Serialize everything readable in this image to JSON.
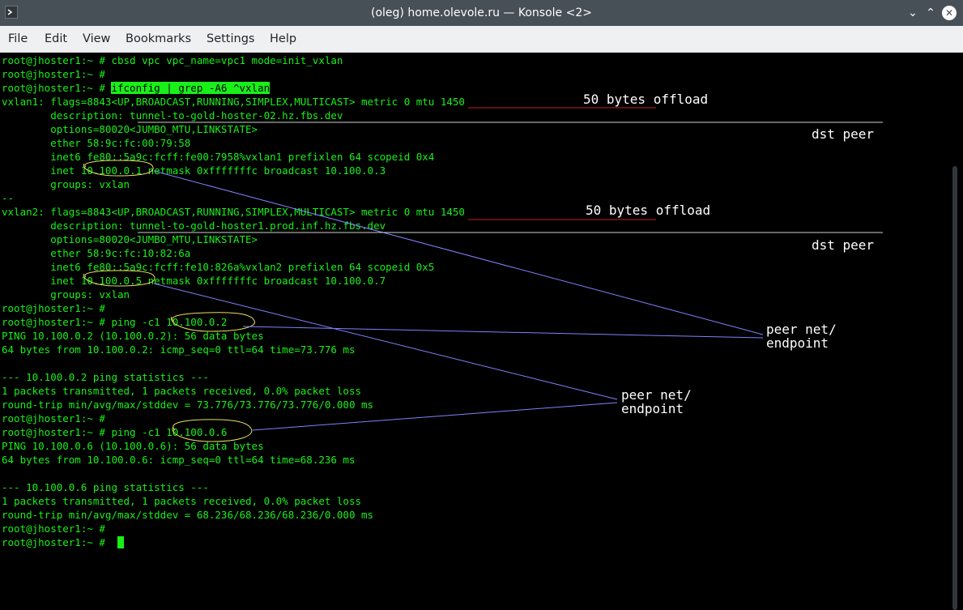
{
  "window": {
    "title": "(oleg) home.olevole.ru — Konsole <2>"
  },
  "menu": [
    "File",
    "Edit",
    "View",
    "Bookmarks",
    "Settings",
    "Help"
  ],
  "terminal": {
    "lines": [
      "root@jhoster1:~ # cbsd vpc vpc_name=vpc1 mode=init_vxlan",
      "root@jhoster1:~ #",
      "root@jhoster1:~ # ",
      "vxlan1: flags=8843<UP,BROADCAST,RUNNING,SIMPLEX,MULTICAST> metric 0 mtu 1450",
      "        description: tunnel-to-gold-hoster-02.hz.fbs.dev",
      "        options=80020<JUMBO_MTU,LINKSTATE>",
      "        ether 58:9c:fc:00:79:58",
      "        inet6 fe80::5a9c:fcff:fe00:7958%vxlan1 prefixlen 64 scopeid 0x4",
      "        inet 10.100.0.1 netmask 0xfffffffc broadcast 10.100.0.3",
      "        groups: vxlan",
      "--",
      "vxlan2: flags=8843<UP,BROADCAST,RUNNING,SIMPLEX,MULTICAST> metric 0 mtu 1450",
      "        description: tunnel-to-gold-hoster1.prod.inf.hz.fbs.dev",
      "        options=80020<JUMBO_MTU,LINKSTATE>",
      "        ether 58:9c:fc:10:82:6a",
      "        inet6 fe80::5a9c:fcff:fe10:826a%vxlan2 prefixlen 64 scopeid 0x5",
      "        inet 10.100.0.5 netmask 0xfffffffc broadcast 10.100.0.7",
      "        groups: vxlan",
      "root@jhoster1:~ #",
      "root@jhoster1:~ # ping -c1 10.100.0.2",
      "PING 10.100.0.2 (10.100.0.2): 56 data bytes",
      "64 bytes from 10.100.0.2: icmp_seq=0 ttl=64 time=73.776 ms",
      "",
      "--- 10.100.0.2 ping statistics ---",
      "1 packets transmitted, 1 packets received, 0.0% packet loss",
      "round-trip min/avg/max/stddev = 73.776/73.776/73.776/0.000 ms",
      "root@jhoster1:~ #",
      "root@jhoster1:~ # ping -c1 10.100.0.6",
      "PING 10.100.0.6 (10.100.0.6): 56 data bytes",
      "64 bytes from 10.100.0.6: icmp_seq=0 ttl=64 time=68.236 ms",
      "",
      "--- 10.100.0.6 ping statistics ---",
      "1 packets transmitted, 1 packets received, 0.0% packet loss",
      "round-trip min/avg/max/stddev = 68.236/68.236/68.236/0.000 ms",
      "root@jhoster1:~ #",
      "root@jhoster1:~ # "
    ],
    "highlighted_command": "ifconfig | grep -A6 ^vxlan"
  },
  "annotations": {
    "offload_1": "50 bytes offload",
    "dst_peer_1": "dst peer",
    "offload_2": "50 bytes offload",
    "dst_peer_2": "dst peer",
    "peer_net_1_line1": "peer net/",
    "peer_net_1_line2": "endpoint",
    "peer_net_2_line1": "peer net/",
    "peer_net_2_line2": "endpoint"
  },
  "colors": {
    "terminal_text": "#18f018",
    "terminal_bg": "#000000",
    "titlebar": "#475057"
  },
  "icons": {
    "app": "konsole-icon",
    "minimize": "chevron-down-icon",
    "maximize": "chevron-up-icon",
    "close": "close-icon"
  }
}
